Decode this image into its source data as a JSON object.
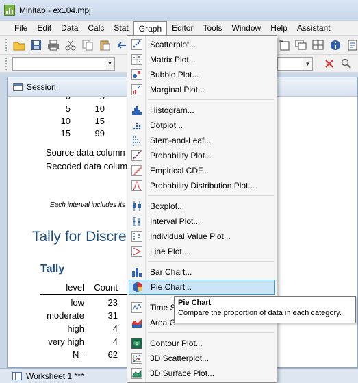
{
  "window": {
    "title": "Minitab - ex104.mpj"
  },
  "menubar": {
    "items": [
      "File",
      "Edit",
      "Data",
      "Calc",
      "Stat",
      "Graph",
      "Editor",
      "Tools",
      "Window",
      "Help",
      "Assistant"
    ],
    "active": "Graph"
  },
  "session": {
    "title": "Session",
    "number_rows": [
      [
        "0",
        "5"
      ],
      [
        "5",
        "10"
      ],
      [
        "10",
        "15"
      ],
      [
        "15",
        "99"
      ]
    ],
    "source_label": "Source data column",
    "recoded_label": "Recoded data column",
    "note": "Each interval includes its",
    "heading": "Tally for Discrete",
    "subheading": "Tally",
    "columns": [
      "level",
      "Count"
    ],
    "rows": [
      [
        "low",
        "23"
      ],
      [
        "moderate",
        "31"
      ],
      [
        "high",
        "4"
      ],
      [
        "very high",
        "4"
      ],
      [
        "N=",
        "62"
      ]
    ]
  },
  "graph_menu": {
    "groups": [
      [
        {
          "label": "Scatterplot...",
          "icon": "scatterplot-icon"
        },
        {
          "label": "Matrix Plot...",
          "icon": "matrix-plot-icon"
        },
        {
          "label": "Bubble Plot...",
          "icon": "bubble-plot-icon"
        },
        {
          "label": "Marginal Plot...",
          "icon": "marginal-plot-icon"
        }
      ],
      [
        {
          "label": "Histogram...",
          "icon": "histogram-icon"
        },
        {
          "label": "Dotplot...",
          "icon": "dotplot-icon"
        },
        {
          "label": "Stem-and-Leaf...",
          "icon": "stem-and-leaf-icon"
        },
        {
          "label": "Probability Plot...",
          "icon": "probability-plot-icon"
        },
        {
          "label": "Empirical CDF...",
          "icon": "empirical-cdf-icon"
        },
        {
          "label": "Probability Distribution Plot...",
          "icon": "probability-distribution-icon"
        }
      ],
      [
        {
          "label": "Boxplot...",
          "icon": "boxplot-icon"
        },
        {
          "label": "Interval Plot...",
          "icon": "interval-plot-icon"
        },
        {
          "label": "Individual Value Plot...",
          "icon": "individual-value-plot-icon"
        },
        {
          "label": "Line Plot...",
          "icon": "line-plot-icon"
        }
      ],
      [
        {
          "label": "Bar Chart...",
          "icon": "bar-chart-icon"
        },
        {
          "label": "Pie Chart...",
          "icon": "pie-chart-icon",
          "highlighted": true
        }
      ],
      [
        {
          "label": "Time S",
          "icon": "time-series-icon"
        },
        {
          "label": "Area G",
          "icon": "area-graph-icon"
        }
      ],
      [
        {
          "label": "Contour Plot...",
          "icon": "contour-plot-icon"
        },
        {
          "label": "3D Scatterplot...",
          "icon": "3d-scatterplot-icon"
        },
        {
          "label": "3D Surface Plot...",
          "icon": "3d-surface-plot-icon"
        }
      ]
    ]
  },
  "tooltip": {
    "title": "Pie Chart",
    "description": "Compare the proportion of data in each category."
  },
  "worksheet_tab": {
    "label": "Worksheet 1 ***"
  },
  "colors": {
    "accent": "#1e4f7c",
    "highlight": "#cce4f7",
    "highlight_border": "#26a0da"
  }
}
